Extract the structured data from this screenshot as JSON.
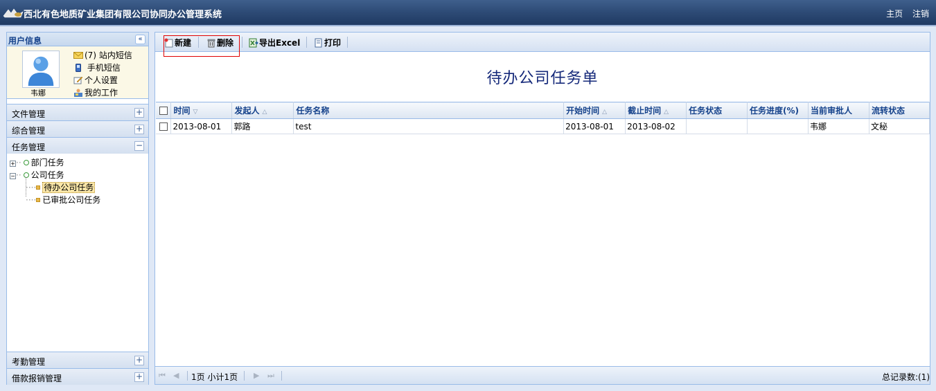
{
  "app": {
    "title": "西北有色地质矿业集团有限公司协同办公管理系统"
  },
  "top_links": {
    "home": "主页",
    "logout": "注销"
  },
  "left_panel": {
    "title": "用户信息",
    "user": {
      "name": "韦娜"
    },
    "user_links": [
      {
        "label": "(7) 站内短信",
        "icon": "mail-icon"
      },
      {
        "label": "手机短信",
        "icon": "phone-icon"
      },
      {
        "label": "个人设置",
        "icon": "edit-icon"
      },
      {
        "label": "我的工作",
        "icon": "work-icon"
      }
    ],
    "sections": [
      {
        "label": "文件管理",
        "state": "+"
      },
      {
        "label": "综合管理",
        "state": "+"
      },
      {
        "label": "任务管理",
        "state": "−"
      }
    ],
    "tree": {
      "dept_tasks": "部门任务",
      "company_tasks": "公司任务",
      "pending_company_tasks": "待办公司任务",
      "approved_company_tasks": "已审批公司任务"
    },
    "bottom_sections": [
      {
        "label": "考勤管理",
        "state": "+"
      },
      {
        "label": "借款报销管理",
        "state": "+"
      }
    ]
  },
  "toolbar": {
    "new_label": "新建",
    "delete_label": "删除",
    "export_label": "导出Excel",
    "print_label": "打印"
  },
  "main": {
    "title": "待办公司任务单"
  },
  "grid": {
    "columns": [
      "时间",
      "发起人",
      "任务名称",
      "开始时间",
      "截止时间",
      "任务状态",
      "任务进度(%)",
      "当前审批人",
      "流转状态"
    ],
    "sort_marks": {
      "time": "▽",
      "initiator": "△",
      "start": "△",
      "end": "△"
    },
    "rows": [
      [
        "2013-08-01",
        "郭路",
        "test",
        "2013-08-01",
        "2013-08-02",
        "",
        "",
        "韦娜",
        "文秘"
      ]
    ]
  },
  "pager": {
    "page_info": "1页 小计1页",
    "total": "总记录数:(1)"
  },
  "colors": {
    "accent": "#15428b",
    "title_blue": "#15297a",
    "highlight_box": "#e00000"
  }
}
